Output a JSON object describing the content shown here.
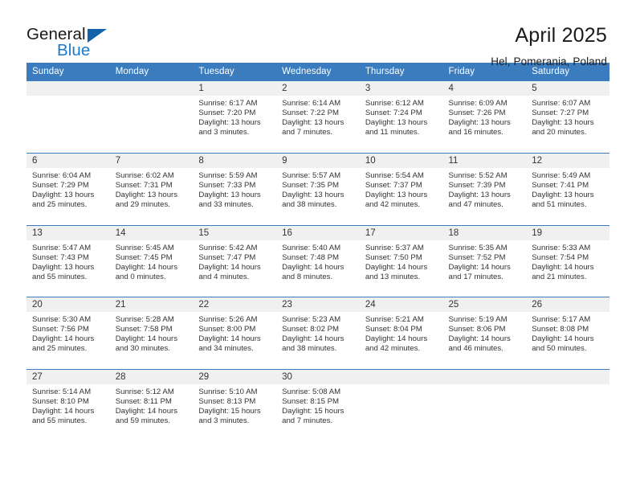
{
  "logo": {
    "word_top": "General",
    "word_bottom": "Blue",
    "triangle_icon": "triangle-icon",
    "color_dark": "#1162A8",
    "color_blue": "#1C7AC9"
  },
  "header": {
    "title": "April 2025",
    "subtitle": "Hel, Pomerania, Poland"
  },
  "theme": {
    "header_bg": "#3A7CBE",
    "daystrip_bg": "#F0F0F0",
    "text": "#333333"
  },
  "weekdays": [
    "Sunday",
    "Monday",
    "Tuesday",
    "Wednesday",
    "Thursday",
    "Friday",
    "Saturday"
  ],
  "weeks": [
    [
      {
        "day": "",
        "sunrise": "",
        "sunset": "",
        "daylight_1": "",
        "daylight_2": ""
      },
      {
        "day": "",
        "sunrise": "",
        "sunset": "",
        "daylight_1": "",
        "daylight_2": ""
      },
      {
        "day": "1",
        "sunrise": "Sunrise: 6:17 AM",
        "sunset": "Sunset: 7:20 PM",
        "daylight_1": "Daylight: 13 hours",
        "daylight_2": "and 3 minutes."
      },
      {
        "day": "2",
        "sunrise": "Sunrise: 6:14 AM",
        "sunset": "Sunset: 7:22 PM",
        "daylight_1": "Daylight: 13 hours",
        "daylight_2": "and 7 minutes."
      },
      {
        "day": "3",
        "sunrise": "Sunrise: 6:12 AM",
        "sunset": "Sunset: 7:24 PM",
        "daylight_1": "Daylight: 13 hours",
        "daylight_2": "and 11 minutes."
      },
      {
        "day": "4",
        "sunrise": "Sunrise: 6:09 AM",
        "sunset": "Sunset: 7:26 PM",
        "daylight_1": "Daylight: 13 hours",
        "daylight_2": "and 16 minutes."
      },
      {
        "day": "5",
        "sunrise": "Sunrise: 6:07 AM",
        "sunset": "Sunset: 7:27 PM",
        "daylight_1": "Daylight: 13 hours",
        "daylight_2": "and 20 minutes."
      }
    ],
    [
      {
        "day": "6",
        "sunrise": "Sunrise: 6:04 AM",
        "sunset": "Sunset: 7:29 PM",
        "daylight_1": "Daylight: 13 hours",
        "daylight_2": "and 25 minutes."
      },
      {
        "day": "7",
        "sunrise": "Sunrise: 6:02 AM",
        "sunset": "Sunset: 7:31 PM",
        "daylight_1": "Daylight: 13 hours",
        "daylight_2": "and 29 minutes."
      },
      {
        "day": "8",
        "sunrise": "Sunrise: 5:59 AM",
        "sunset": "Sunset: 7:33 PM",
        "daylight_1": "Daylight: 13 hours",
        "daylight_2": "and 33 minutes."
      },
      {
        "day": "9",
        "sunrise": "Sunrise: 5:57 AM",
        "sunset": "Sunset: 7:35 PM",
        "daylight_1": "Daylight: 13 hours",
        "daylight_2": "and 38 minutes."
      },
      {
        "day": "10",
        "sunrise": "Sunrise: 5:54 AM",
        "sunset": "Sunset: 7:37 PM",
        "daylight_1": "Daylight: 13 hours",
        "daylight_2": "and 42 minutes."
      },
      {
        "day": "11",
        "sunrise": "Sunrise: 5:52 AM",
        "sunset": "Sunset: 7:39 PM",
        "daylight_1": "Daylight: 13 hours",
        "daylight_2": "and 47 minutes."
      },
      {
        "day": "12",
        "sunrise": "Sunrise: 5:49 AM",
        "sunset": "Sunset: 7:41 PM",
        "daylight_1": "Daylight: 13 hours",
        "daylight_2": "and 51 minutes."
      }
    ],
    [
      {
        "day": "13",
        "sunrise": "Sunrise: 5:47 AM",
        "sunset": "Sunset: 7:43 PM",
        "daylight_1": "Daylight: 13 hours",
        "daylight_2": "and 55 minutes."
      },
      {
        "day": "14",
        "sunrise": "Sunrise: 5:45 AM",
        "sunset": "Sunset: 7:45 PM",
        "daylight_1": "Daylight: 14 hours",
        "daylight_2": "and 0 minutes."
      },
      {
        "day": "15",
        "sunrise": "Sunrise: 5:42 AM",
        "sunset": "Sunset: 7:47 PM",
        "daylight_1": "Daylight: 14 hours",
        "daylight_2": "and 4 minutes."
      },
      {
        "day": "16",
        "sunrise": "Sunrise: 5:40 AM",
        "sunset": "Sunset: 7:48 PM",
        "daylight_1": "Daylight: 14 hours",
        "daylight_2": "and 8 minutes."
      },
      {
        "day": "17",
        "sunrise": "Sunrise: 5:37 AM",
        "sunset": "Sunset: 7:50 PM",
        "daylight_1": "Daylight: 14 hours",
        "daylight_2": "and 13 minutes."
      },
      {
        "day": "18",
        "sunrise": "Sunrise: 5:35 AM",
        "sunset": "Sunset: 7:52 PM",
        "daylight_1": "Daylight: 14 hours",
        "daylight_2": "and 17 minutes."
      },
      {
        "day": "19",
        "sunrise": "Sunrise: 5:33 AM",
        "sunset": "Sunset: 7:54 PM",
        "daylight_1": "Daylight: 14 hours",
        "daylight_2": "and 21 minutes."
      }
    ],
    [
      {
        "day": "20",
        "sunrise": "Sunrise: 5:30 AM",
        "sunset": "Sunset: 7:56 PM",
        "daylight_1": "Daylight: 14 hours",
        "daylight_2": "and 25 minutes."
      },
      {
        "day": "21",
        "sunrise": "Sunrise: 5:28 AM",
        "sunset": "Sunset: 7:58 PM",
        "daylight_1": "Daylight: 14 hours",
        "daylight_2": "and 30 minutes."
      },
      {
        "day": "22",
        "sunrise": "Sunrise: 5:26 AM",
        "sunset": "Sunset: 8:00 PM",
        "daylight_1": "Daylight: 14 hours",
        "daylight_2": "and 34 minutes."
      },
      {
        "day": "23",
        "sunrise": "Sunrise: 5:23 AM",
        "sunset": "Sunset: 8:02 PM",
        "daylight_1": "Daylight: 14 hours",
        "daylight_2": "and 38 minutes."
      },
      {
        "day": "24",
        "sunrise": "Sunrise: 5:21 AM",
        "sunset": "Sunset: 8:04 PM",
        "daylight_1": "Daylight: 14 hours",
        "daylight_2": "and 42 minutes."
      },
      {
        "day": "25",
        "sunrise": "Sunrise: 5:19 AM",
        "sunset": "Sunset: 8:06 PM",
        "daylight_1": "Daylight: 14 hours",
        "daylight_2": "and 46 minutes."
      },
      {
        "day": "26",
        "sunrise": "Sunrise: 5:17 AM",
        "sunset": "Sunset: 8:08 PM",
        "daylight_1": "Daylight: 14 hours",
        "daylight_2": "and 50 minutes."
      }
    ],
    [
      {
        "day": "27",
        "sunrise": "Sunrise: 5:14 AM",
        "sunset": "Sunset: 8:10 PM",
        "daylight_1": "Daylight: 14 hours",
        "daylight_2": "and 55 minutes."
      },
      {
        "day": "28",
        "sunrise": "Sunrise: 5:12 AM",
        "sunset": "Sunset: 8:11 PM",
        "daylight_1": "Daylight: 14 hours",
        "daylight_2": "and 59 minutes."
      },
      {
        "day": "29",
        "sunrise": "Sunrise: 5:10 AM",
        "sunset": "Sunset: 8:13 PM",
        "daylight_1": "Daylight: 15 hours",
        "daylight_2": "and 3 minutes."
      },
      {
        "day": "30",
        "sunrise": "Sunrise: 5:08 AM",
        "sunset": "Sunset: 8:15 PM",
        "daylight_1": "Daylight: 15 hours",
        "daylight_2": "and 7 minutes."
      },
      {
        "day": "",
        "sunrise": "",
        "sunset": "",
        "daylight_1": "",
        "daylight_2": ""
      },
      {
        "day": "",
        "sunrise": "",
        "sunset": "",
        "daylight_1": "",
        "daylight_2": ""
      },
      {
        "day": "",
        "sunrise": "",
        "sunset": "",
        "daylight_1": "",
        "daylight_2": ""
      }
    ]
  ]
}
